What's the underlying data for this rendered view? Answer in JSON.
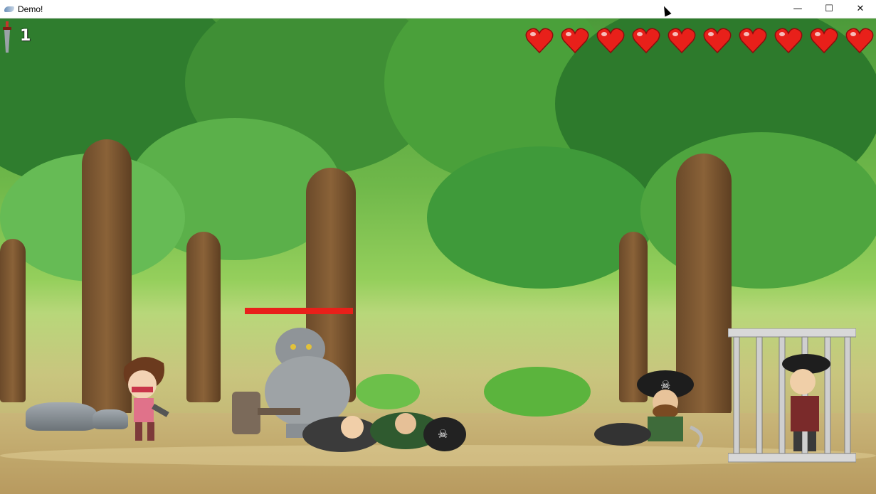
{
  "window": {
    "title": "Demo!",
    "controls": [
      "minimize",
      "maximize",
      "close"
    ]
  },
  "hud": {
    "weapon_icon": "dagger-icon",
    "count": "1",
    "hearts_count": 10,
    "heart_color": "#e8201a"
  },
  "boss": {
    "name": "troll",
    "health_fraction": 1.0,
    "health_bar_color": "#e8201a"
  },
  "scene": {
    "background": "forest",
    "characters": [
      "player-ninja-girl",
      "troll-boss",
      "fallen-pirates-left",
      "pirate-captain-crouching",
      "caged-pirate-girl"
    ]
  }
}
